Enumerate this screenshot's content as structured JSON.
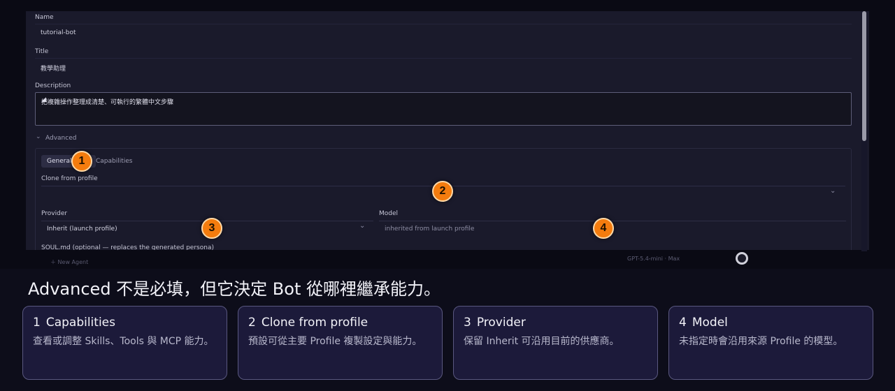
{
  "form": {
    "name_label": "Name",
    "name_value": "tutorial-bot",
    "title_label": "Title",
    "title_value": "教學助理",
    "description_label": "Description",
    "description_value": "把複雜操作整理成清楚、可執行的繁體中文步驟",
    "advanced_label": "Advanced",
    "tabs": {
      "general": "General",
      "capabilities": "Capabilities"
    },
    "clone_label": "Clone from profile",
    "provider_label": "Provider",
    "provider_value": "Inherit (launch profile)",
    "model_label": "Model",
    "model_placeholder": "inherited from launch profile",
    "soul_label": "SOUL.md (optional — replaces the generated persona)"
  },
  "background": {
    "new_agent": "New Agent",
    "status_text": "GPT-5.4-mini · Max"
  },
  "markers": [
    "1",
    "2",
    "3",
    "4"
  ],
  "caption": "Advanced 不是必填，但它決定 Bot 從哪裡繼承能力。",
  "cards": [
    {
      "num": "1",
      "title": "Capabilities",
      "body": "查看或調整 Skills、Tools 與 MCP 能力。"
    },
    {
      "num": "2",
      "title": "Clone from profile",
      "body": "預設可從主要 Profile 複製設定與能力。"
    },
    {
      "num": "3",
      "title": "Provider",
      "body": "保留 Inherit 可沿用目前的供應商。"
    },
    {
      "num": "4",
      "title": "Model",
      "body": "未指定時會沿用來源 Profile 的模型。"
    }
  ],
  "colors": {
    "marker": "#f47c0e",
    "card_bg": "#1c1a3a",
    "card_border": "#5a5880",
    "page_bg": "#0d0d1a"
  }
}
